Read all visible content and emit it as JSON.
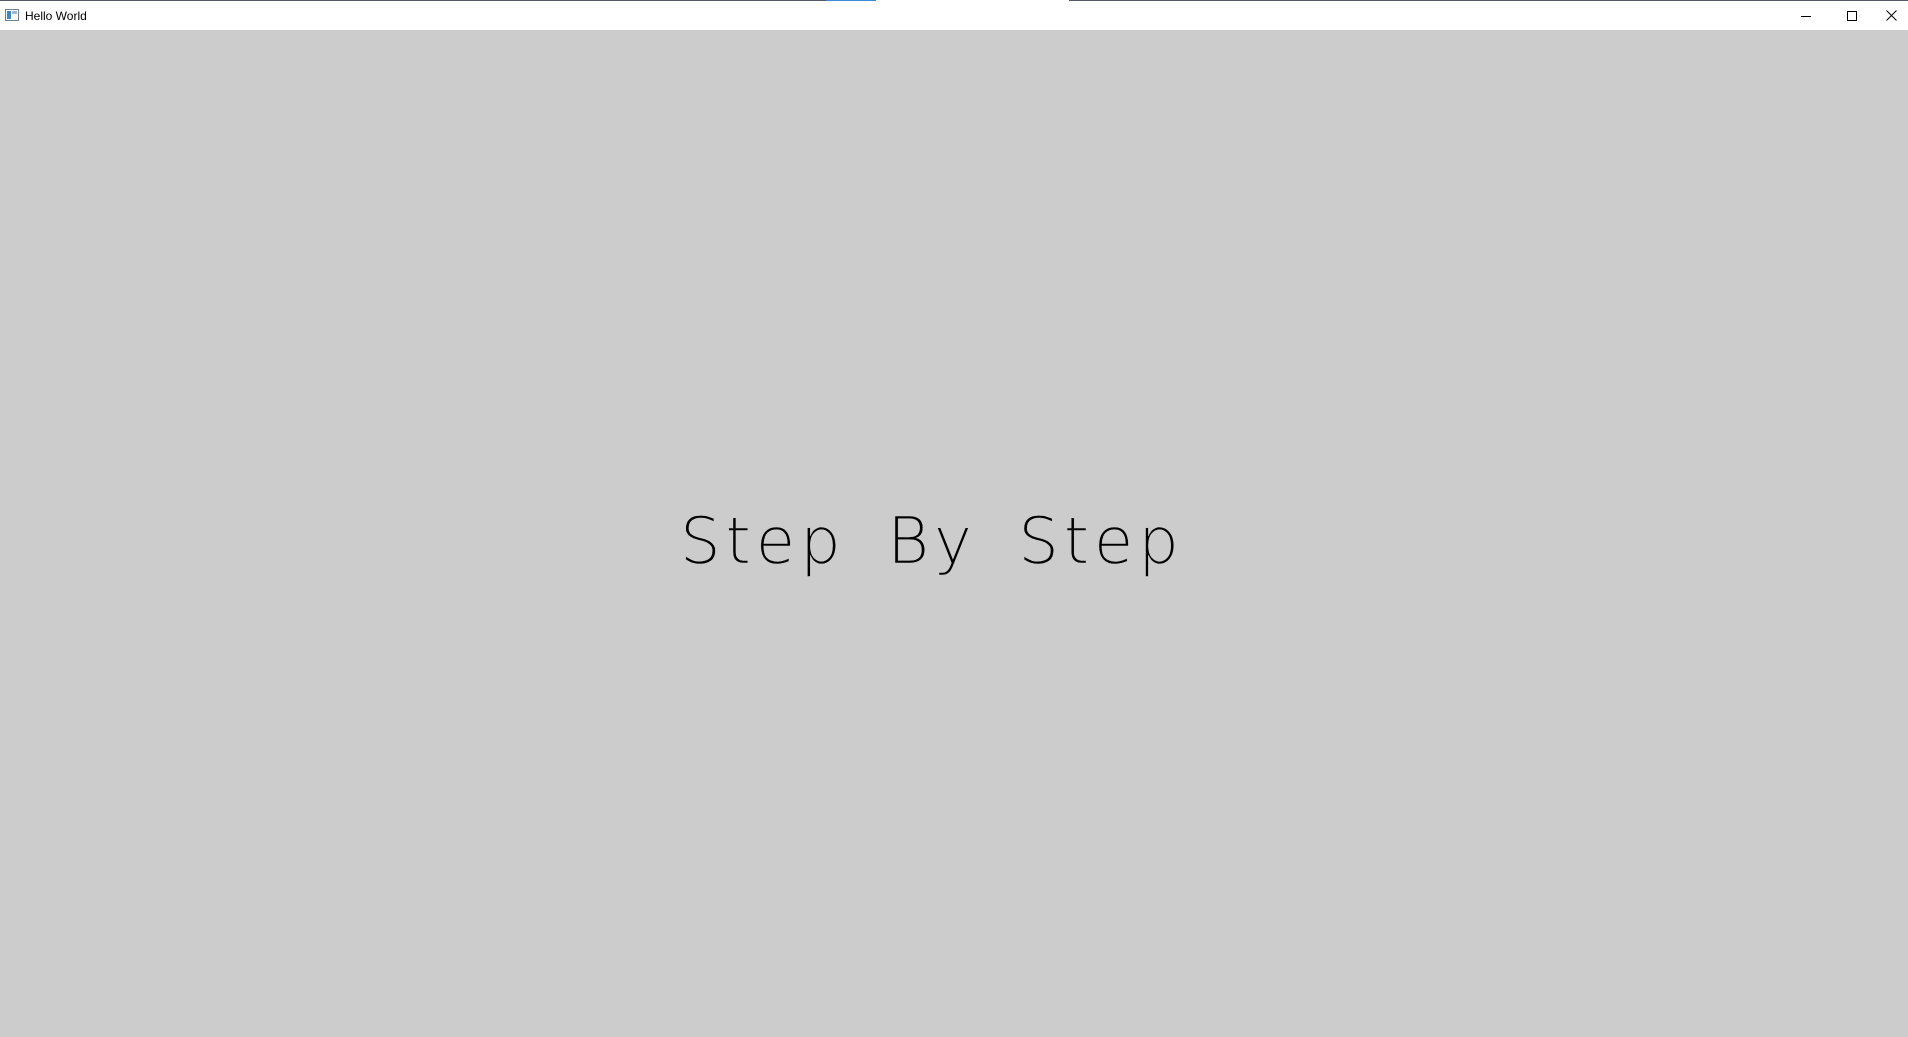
{
  "window": {
    "title": "Hello World",
    "controls": {
      "minimize_icon": "minimize-icon",
      "maximize_icon": "maximize-icon",
      "close_icon": "close-icon"
    }
  },
  "content": {
    "headline": "Step By Step",
    "background_color": "#cccccc",
    "text_color": "#000000"
  }
}
